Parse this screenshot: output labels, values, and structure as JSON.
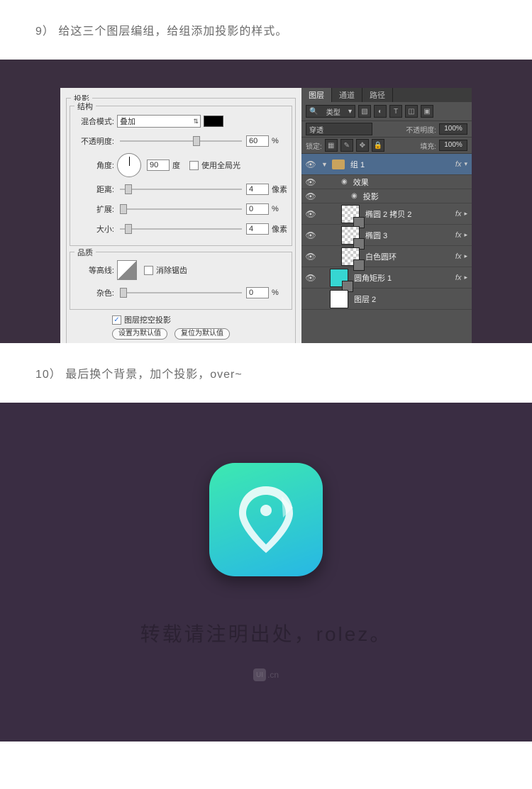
{
  "step9_text": "9） 给这三个图层编组，给组添加投影的样式。",
  "step10_text": "10） 最后换个背景，加个投影，over~",
  "left_panel": {
    "section_shadow": "投影",
    "section_structure": "结构",
    "blend_mode_label": "混合模式:",
    "blend_mode_value": "叠加",
    "opacity_label": "不透明度:",
    "opacity_value": "60",
    "opacity_unit": "%",
    "angle_label": "角度:",
    "angle_value": "90",
    "angle_unit": "度",
    "global_light": "使用全局光",
    "distance_label": "距离:",
    "distance_value": "4",
    "distance_unit": "像素",
    "spread_label": "扩展:",
    "spread_value": "0",
    "spread_unit": "%",
    "size_label": "大小:",
    "size_value": "4",
    "size_unit": "像素",
    "section_quality": "品质",
    "contour_label": "等高线:",
    "antialiased": "消除锯齿",
    "noise_label": "杂色:",
    "noise_value": "0",
    "noise_unit": "%",
    "knockout": "图层挖空投影",
    "btn_default": "设置为默认值",
    "btn_reset": "复位为默认值"
  },
  "right_panel": {
    "tab_layers": "图层",
    "tab_channels": "通道",
    "tab_paths": "路径",
    "filter_label": "类型",
    "mode_label": "穿透",
    "opacity_label": "不透明度:",
    "opacity_val": "100%",
    "lock_label": "锁定:",
    "fill_label": "填充:",
    "fill_val": "100%",
    "layers": {
      "group1": "组 1",
      "fx_label": "fx",
      "effects": "效果",
      "shadow": "投影",
      "ellipse_copy": "椭圆 2 拷贝 2",
      "ellipse3": "椭圆 3",
      "white_ring": "白色圆环",
      "round_rect": "圆角矩形 1",
      "layer2": "图层 2"
    }
  },
  "credit_text": "转载请注明出处，rolez。",
  "watermark": ".cn",
  "watermark_badge": "UI"
}
